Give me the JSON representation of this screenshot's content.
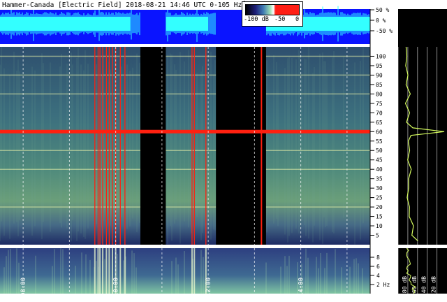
{
  "title": "Hammer-Canada [Electric Field] 2018-08-21 14:46 UTC 0-105 Hz",
  "colorbar": {
    "labels": [
      "-100 dB",
      "-50",
      "0"
    ]
  },
  "colors": {
    "background": "#0f1436",
    "hum": "#ff2010",
    "top_panel": "#0a14ff",
    "waveform": "#33ffff",
    "spectrum_line": "#d8ff60"
  },
  "chart_data": {
    "type": "heatmap",
    "title": "Hammer-Canada [Electric Field] 2018-08-21 14:46 UTC 0-105 Hz",
    "x_ticks": [
      "08:00",
      "10:00",
      "12:00",
      "14:00"
    ],
    "x_range_hours": [
      7.5,
      15.5
    ],
    "y_range_hz": [
      0,
      105
    ],
    "y_ticks": [
      "100",
      "95",
      "90",
      "85",
      "80",
      "75",
      "70",
      "65",
      "60",
      "55",
      "50",
      "45",
      "40",
      "35",
      "30",
      "25",
      "20",
      "15",
      "10",
      "5"
    ],
    "zoom_ticks": [
      "8",
      "6",
      "4",
      "2 Hz"
    ],
    "zoom_range_hz": [
      0,
      10
    ],
    "amplitude_ticks": [
      "50 %",
      "0 %",
      "-50 %"
    ],
    "spectrum_ticks": [
      "-100 dB",
      "-80 dB",
      "-60 dB",
      "-40 dB",
      "-20 dB"
    ],
    "dominant_lines_hz": [
      60,
      20,
      40,
      80,
      100,
      90,
      50
    ],
    "data_gaps": [
      [
        "10:32",
        "11:05"
      ],
      [
        "12:10",
        "13:15"
      ]
    ],
    "spectrum_profile": [
      {
        "hz": 2,
        "db": -60
      },
      {
        "hz": 5,
        "db": -72
      },
      {
        "hz": 10,
        "db": -70
      },
      {
        "hz": 15,
        "db": -80
      },
      {
        "hz": 20,
        "db": -75
      },
      {
        "hz": 25,
        "db": -83
      },
      {
        "hz": 30,
        "db": -82
      },
      {
        "hz": 35,
        "db": -80
      },
      {
        "hz": 40,
        "db": -75
      },
      {
        "hz": 45,
        "db": -83
      },
      {
        "hz": 50,
        "db": -78
      },
      {
        "hz": 55,
        "db": -82
      },
      {
        "hz": 58,
        "db": -70
      },
      {
        "hz": 60,
        "db": -5
      },
      {
        "hz": 62,
        "db": -70
      },
      {
        "hz": 65,
        "db": -82
      },
      {
        "hz": 70,
        "db": -80
      },
      {
        "hz": 75,
        "db": -82
      },
      {
        "hz": 80,
        "db": -77
      },
      {
        "hz": 85,
        "db": -82
      },
      {
        "hz": 90,
        "db": -80
      },
      {
        "hz": 95,
        "db": -84
      },
      {
        "hz": 100,
        "db": -78
      },
      {
        "hz": 105,
        "db": -85
      }
    ]
  }
}
